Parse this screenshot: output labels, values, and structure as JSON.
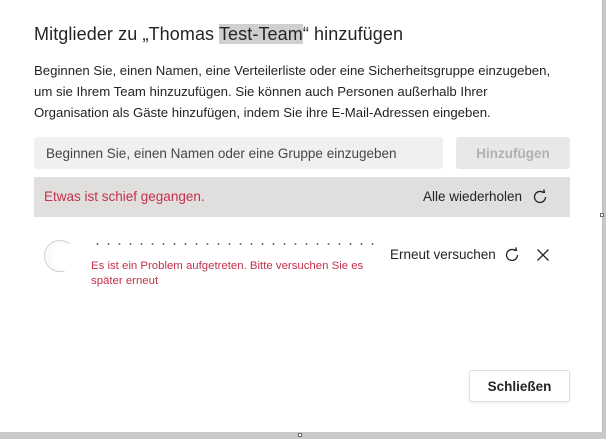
{
  "dialog": {
    "title_prefix": "Mitglieder zu „Thomas ",
    "title_highlight": "Test-Team",
    "title_suffix": "“ hinzufügen",
    "description": "Beginnen Sie, einen Namen, eine Verteilerliste oder eine Sicherheitsgruppe einzugeben, um sie Ihrem Team hinzuzufügen. Sie können auch Personen außerhalb Ihrer Organisation als Gäste hinzufügen, indem Sie ihre E-Mail-Adressen eingeben."
  },
  "search": {
    "placeholder": "Beginnen Sie, einen Namen oder eine Gruppe einzugeben",
    "value": ""
  },
  "add_button": {
    "label": "Hinzufügen",
    "enabled": false
  },
  "error_banner": {
    "message": "Etwas ist schief gegangen.",
    "retry_all_label": "Alle wiederholen"
  },
  "member_row": {
    "error_message": "Es ist ein Problem aufgetreten. Bitte versuchen Sie es später erneut",
    "retry_label": "Erneut versuchen"
  },
  "footer": {
    "close_label": "Schließen"
  },
  "icons": {
    "retry": "retry-icon",
    "close": "close-icon"
  },
  "colors": {
    "error_text": "#c4314b",
    "banner_bg": "#e1dfdd",
    "input_bg": "#f0f0f0",
    "disabled_text": "#b3b0ad"
  }
}
